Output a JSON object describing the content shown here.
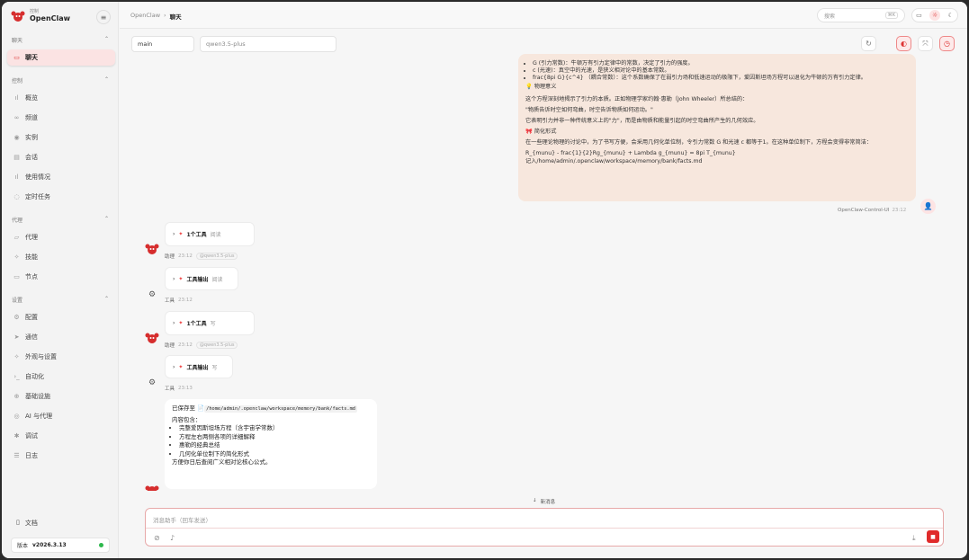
{
  "brand": {
    "small": "控制",
    "name": "OpenClaw"
  },
  "sidebar": {
    "sections": [
      {
        "label": "聊天",
        "items": [
          {
            "label": "聊天",
            "icon": "chat-icon"
          }
        ]
      },
      {
        "label": "控制",
        "items": [
          {
            "label": "概览",
            "icon": "bar-chart-icon"
          },
          {
            "label": "频道",
            "icon": "link-icon"
          },
          {
            "label": "实例",
            "icon": "signal-icon"
          },
          {
            "label": "会话",
            "icon": "document-icon"
          },
          {
            "label": "使用情况",
            "icon": "bar-chart-icon"
          },
          {
            "label": "定时任务",
            "icon": "clock-icon"
          }
        ]
      },
      {
        "label": "代理",
        "items": [
          {
            "label": "代理",
            "icon": "folder-icon"
          },
          {
            "label": "技能",
            "icon": "sparkle-icon"
          },
          {
            "label": "节点",
            "icon": "monitor-icon"
          }
        ]
      },
      {
        "label": "设置",
        "items": [
          {
            "label": "配置",
            "icon": "gear-icon"
          },
          {
            "label": "通信",
            "icon": "send-icon"
          },
          {
            "label": "外观与设置",
            "icon": "sparkle-icon"
          },
          {
            "label": "自动化",
            "icon": "terminal-icon"
          },
          {
            "label": "基础设施",
            "icon": "globe-icon"
          },
          {
            "label": "AI 与代理",
            "icon": "brain-icon"
          },
          {
            "label": "调试",
            "icon": "bug-icon"
          },
          {
            "label": "日志",
            "icon": "logs-icon"
          }
        ]
      }
    ],
    "docs_label": "文档",
    "version_label": "版本",
    "version": "v2026.3.13"
  },
  "topbar": {
    "breadcrumb_root": "OpenClaw",
    "breadcrumb_sep": "›",
    "breadcrumb_current": "聊天",
    "search_placeholder": "搜索",
    "search_shortcut": "⌘K"
  },
  "session": {
    "name": "main",
    "model": "qwen3.5-plus"
  },
  "user_message": {
    "bullets": [
      "G (引力常数)：牛顿万有引力定律中的常数，决定了引力的强度。",
      "c (光速)：真空中的光速，是狭义相对论中的基本常数。",
      "frac{8pi G}{c^4} （耦合常数）：这个系数确保了在弱引力场和低速运动的极限下，爱因斯坦场方程可以退化为牛顿的万有引力定律。"
    ],
    "heading_meaning": "物理意义",
    "para1": "这个方程深刻地揭示了引力的本质。正如物理学家约翰·惠勒（John Wheeler）所总结的：",
    "quote": "\"物质告诉时空如何弯曲，时空告诉物质如何运动。\"",
    "para2": "它表明引力并非一种传统意义上的\"力\"，而是由物质和能量引起的时空弯曲所产生的几何效应。",
    "heading_simplified": "简化形式",
    "para3": "在一些理论物理的讨论中，为了书写方便，会采用几何化单位制，令引力常数 G 和光速 c 都等于1。在这种单位制下，方程会变得非常简洁：",
    "formula": "R_{munu} - frac{1}{2}Rg_{munu} + Lambda g_{munu} = 8pi T_{munu}",
    "saved_note": "记入/home/admin/.openclaw/workspace/memory/bank/facts.md",
    "sender": "OpenClaw-Control-UI",
    "time": "23:12"
  },
  "tool_events": [
    {
      "card": {
        "count": "1个工具",
        "action": "阅读"
      },
      "role": "助理",
      "time": "23:12",
      "model": "@qwen3.5-plus"
    },
    {
      "card": {
        "count": "工具输出",
        "action": "阅读"
      },
      "role": "工具",
      "time": "23:12"
    },
    {
      "card": {
        "count": "1个工具",
        "action": "写"
      },
      "role": "助理",
      "time": "23:12",
      "model": "@qwen3.5-plus"
    },
    {
      "card": {
        "count": "工具输出",
        "action": "写"
      },
      "role": "工具",
      "time": "23:13"
    }
  ],
  "assistant_message": {
    "saved_prefix": "已保存至",
    "path": "/home/admin/.openclaw/workspace/memory/bank/facts.md",
    "contents_label": "内容包含：",
    "items": [
      "完整爱因斯坦场方程（含宇宙学常数）",
      "方程左右两侧各项的详细解释",
      "惠勒的经典总结",
      "几何化单位制下的简化形式"
    ],
    "footer": "方便你日后查阅广义相对论核心公式。"
  },
  "new_messages_label": "新消息",
  "composer": {
    "placeholder": "消息助手（回车发送）"
  },
  "colors": {
    "accent": "#e02b2b",
    "user_bubble": "#f7e7dd",
    "active_nav": "#fbe3e3",
    "status_online": "#2db84c"
  }
}
